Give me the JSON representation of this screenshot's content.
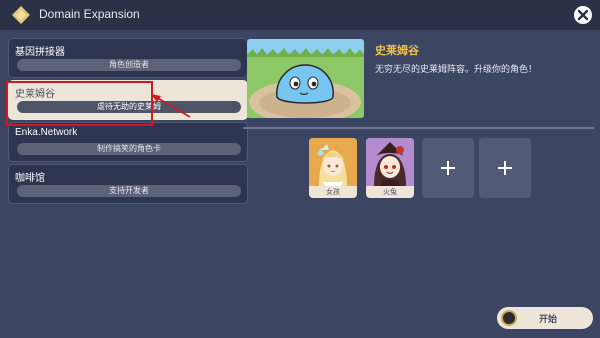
{
  "window": {
    "title": "Domain Expansion"
  },
  "domains": [
    {
      "name": "基因拼接器",
      "subtitle": "角色创造者"
    },
    {
      "name": "史莱姆谷",
      "subtitle": "虐待无助的史莱姆"
    },
    {
      "name": "Enka.Network",
      "subtitle": "制作搞笑的角色卡"
    },
    {
      "name": "咖啡馆",
      "subtitle": "支持开发者"
    }
  ],
  "selected_domain_index": 1,
  "detail": {
    "title": "史莱姆谷",
    "description": "无穷无尽的史莱姆阵容。升级你的角色！"
  },
  "team": [
    {
      "label": "女孩",
      "icon": "lumine-portrait"
    },
    {
      "label": "火兔",
      "icon": "hutao-portrait"
    }
  ],
  "add_slots": [
    {
      "glyph": "+"
    },
    {
      "glyph": "+"
    }
  ],
  "start_button": {
    "label": "开始"
  },
  "colors": {
    "background": "#3c4562",
    "title_bar": "#2b3147",
    "panel": "#2e3550",
    "selected": "#ece5d8",
    "accent_gold": "#f1c04a",
    "annotation_red": "#d0191f"
  }
}
